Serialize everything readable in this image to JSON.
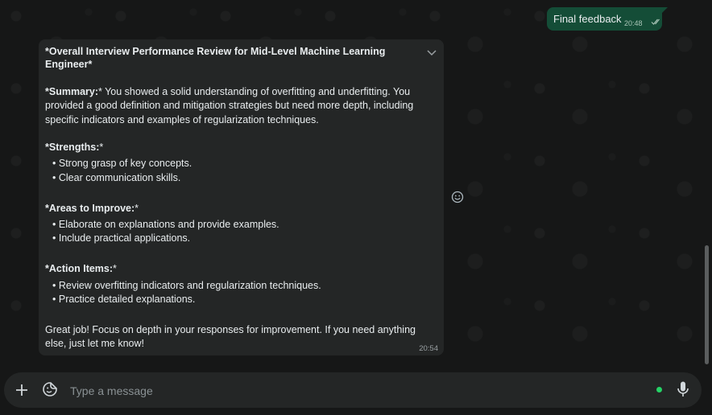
{
  "outgoing": {
    "text": "Final feedback",
    "time": "20:48"
  },
  "incoming": {
    "title_line1": "*Overall Interview Performance Review for Mid-Level Machine Learning",
    "title_line2": "Engineer*",
    "summary_label": "*Summary:",
    "summary_line1": "* You showed a solid understanding of overfitting and underfitting. You",
    "summary_line2": "provided a good definition and mitigation strategies but need more depth, including",
    "summary_line3": "specific indicators and examples of regularization techniques.",
    "strengths_label": "*Strengths:",
    "strengths_suffix": "*",
    "strengths": [
      "Strong grasp of key concepts.",
      "Clear communication skills."
    ],
    "improve_label": "*Areas to Improve:",
    "improve_suffix": "*",
    "improve": [
      "Elaborate on explanations and provide examples.",
      "Include practical applications."
    ],
    "actions_label": "*Action Items:",
    "actions_suffix": "*",
    "actions": [
      "Review overfitting indicators and regularization techniques.",
      "Practice detailed explanations."
    ],
    "closing_line1": "Great job! Focus on depth in your responses for improvement. If you need anything",
    "closing_line2": "else, just let me know!",
    "time": "20:54"
  },
  "composer": {
    "placeholder": "Type a message"
  },
  "icons": {
    "add": "plus-icon",
    "sticker": "sticker-icon",
    "mic": "microphone-icon",
    "react": "emoji-reaction-icon",
    "menu": "chevron-down-icon",
    "read": "double-check-icon"
  },
  "colors": {
    "outgoing_bubble": "#144d37",
    "incoming_bubble": "#242626",
    "background": "#161717",
    "accent": "#25d366"
  }
}
